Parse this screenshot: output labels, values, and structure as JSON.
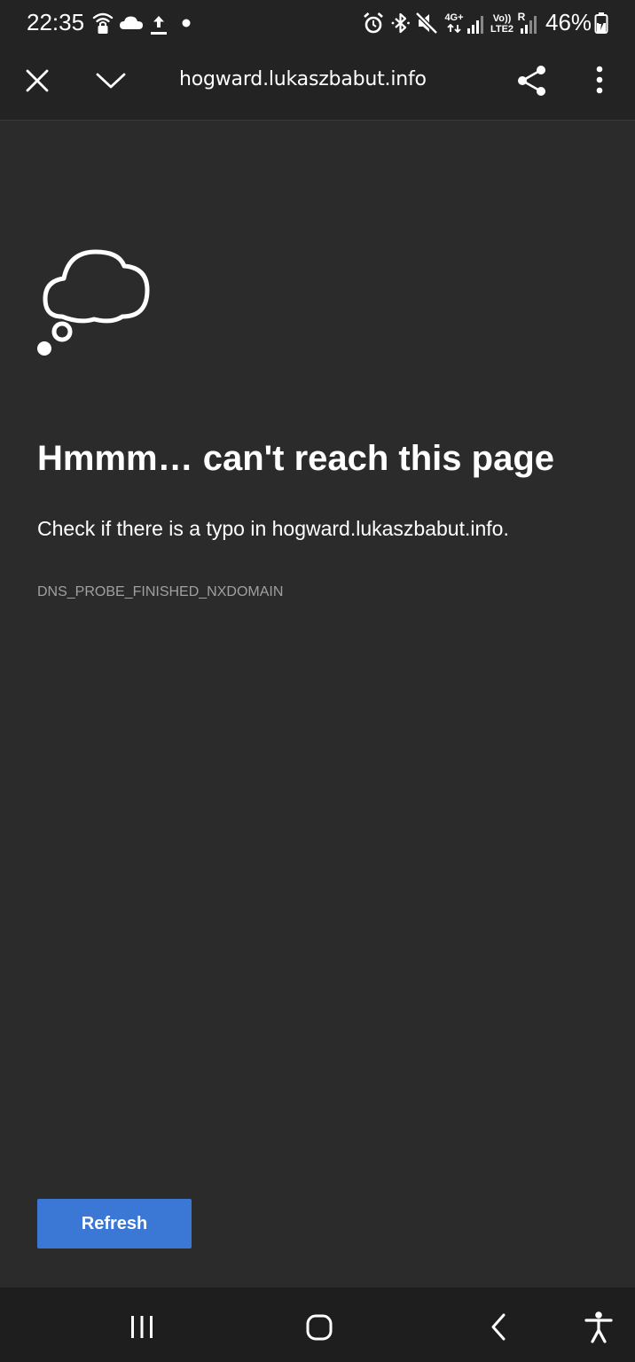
{
  "status_bar": {
    "time": "22:35",
    "battery": "46%",
    "network_type": "4G+",
    "volte_label": "Vo))",
    "lte_label": "LTE2",
    "roaming_label": "R",
    "left_icons": [
      "wifi-lock-icon",
      "cloud-icon",
      "upload-icon",
      "notification-dot-icon"
    ],
    "right_icons": [
      "alarm-icon",
      "bluetooth-icon",
      "mute-icon",
      "signal-icon",
      "signal-icon",
      "battery-charging-icon"
    ]
  },
  "toolbar": {
    "url": "hogward.lukaszbabut.info",
    "icons": [
      "close-icon",
      "chevron-down-icon",
      "share-icon",
      "more-vert-icon"
    ]
  },
  "error_page": {
    "illustration": "thought-cloud-icon",
    "heading": "Hmmm… can't reach this page",
    "description": "Check if there is a typo in hogward.lukaszbabut.info.",
    "error_code": "DNS_PROBE_FINISHED_NXDOMAIN",
    "refresh_label": "Refresh",
    "button_color": "#3b78d6",
    "background_color": "#2b2b2b"
  },
  "nav_bar": {
    "buttons": [
      "recents-icon",
      "home-icon",
      "back-icon",
      "accessibility-icon"
    ]
  }
}
